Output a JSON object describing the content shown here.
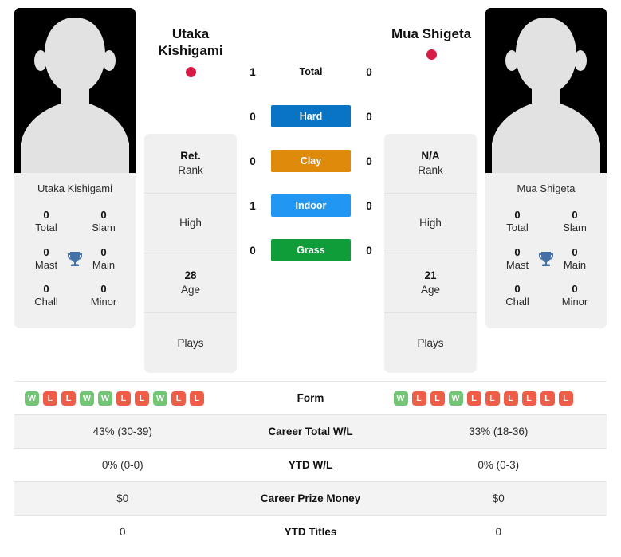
{
  "players": {
    "left": {
      "name": "Utaka Kishigami",
      "headline_line1": "Utaka",
      "headline_line2": "Kishigami",
      "flag_color": "#d81b45",
      "titles": [
        {
          "num": "0",
          "label": "Total"
        },
        {
          "num": "0",
          "label": "Slam"
        },
        {
          "num": "0",
          "label": "Mast"
        },
        {
          "num": "0",
          "label": "Main"
        },
        {
          "num": "0",
          "label": "Chall"
        },
        {
          "num": "0",
          "label": "Minor"
        }
      ],
      "info": [
        {
          "value": "Ret.",
          "caption": "Rank"
        },
        {
          "value": "",
          "caption": "High"
        },
        {
          "value": "28",
          "caption": "Age"
        },
        {
          "value": "",
          "caption": "Plays"
        }
      ],
      "form": [
        "W",
        "L",
        "L",
        "W",
        "W",
        "L",
        "L",
        "W",
        "L",
        "L"
      ],
      "career_total_wl": "43% (30-39)",
      "ytd_wl": "0% (0-0)",
      "career_prize_money": "$0",
      "ytd_titles": "0"
    },
    "right": {
      "name": "Mua Shigeta",
      "headline_line1": "Mua Shigeta",
      "headline_line2": "",
      "flag_color": "#d81b45",
      "titles": [
        {
          "num": "0",
          "label": "Total"
        },
        {
          "num": "0",
          "label": "Slam"
        },
        {
          "num": "0",
          "label": "Mast"
        },
        {
          "num": "0",
          "label": "Main"
        },
        {
          "num": "0",
          "label": "Chall"
        },
        {
          "num": "0",
          "label": "Minor"
        }
      ],
      "info": [
        {
          "value": "N/A",
          "caption": "Rank"
        },
        {
          "value": "",
          "caption": "High"
        },
        {
          "value": "21",
          "caption": "Age"
        },
        {
          "value": "",
          "caption": "Plays"
        }
      ],
      "form": [
        "W",
        "L",
        "L",
        "W",
        "L",
        "L",
        "L",
        "L",
        "L",
        "L"
      ],
      "career_total_wl": "33% (18-36)",
      "ytd_wl": "0% (0-3)",
      "career_prize_money": "$0",
      "ytd_titles": "0"
    }
  },
  "h2h": [
    {
      "label": "Total",
      "left": "1",
      "right": "0",
      "style": "plain",
      "color": ""
    },
    {
      "label": "Hard",
      "left": "0",
      "right": "0",
      "style": "badge",
      "color": "#0a74c4"
    },
    {
      "label": "Clay",
      "left": "0",
      "right": "0",
      "style": "badge",
      "color": "#e08a0b"
    },
    {
      "label": "Indoor",
      "left": "1",
      "right": "0",
      "style": "badge",
      "color": "#2196f3"
    },
    {
      "label": "Grass",
      "left": "0",
      "right": "0",
      "style": "badge",
      "color": "#0f9d3a"
    }
  ],
  "table_rows": [
    {
      "label": "Form",
      "key": "form",
      "type": "form"
    },
    {
      "label": "Career Total W/L",
      "key": "career_total_wl",
      "type": "text"
    },
    {
      "label": "YTD W/L",
      "key": "ytd_wl",
      "type": "text"
    },
    {
      "label": "Career Prize Money",
      "key": "career_prize_money",
      "type": "text"
    },
    {
      "label": "YTD Titles",
      "key": "ytd_titles",
      "type": "text"
    }
  ],
  "colors": {
    "form_win": "#74c476",
    "form_loss": "#ee5d48",
    "trophy": "#4472a8",
    "card_bg": "#f0f0f0",
    "row_shaded": "#f3f3f3"
  }
}
